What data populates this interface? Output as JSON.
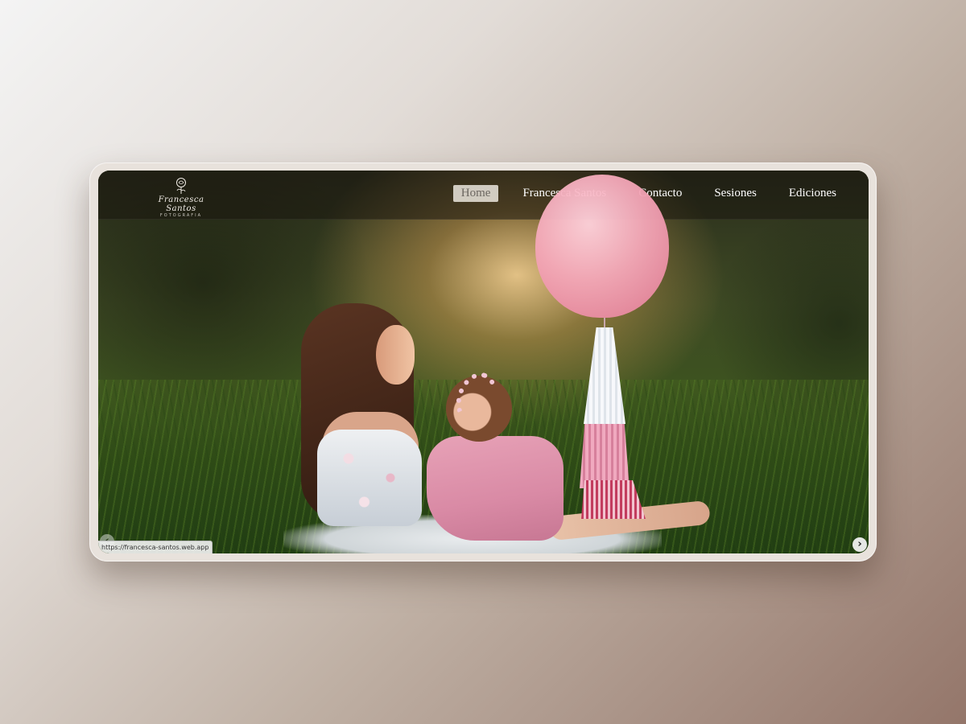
{
  "brand": {
    "logo_script": "Francesca Santos",
    "logo_sub": "FOTOGRAFIA"
  },
  "nav": {
    "items": [
      "Home",
      "Francesca Santos",
      "Contacto",
      "Sesiones",
      "Ediciones"
    ],
    "active": "Home"
  },
  "hero": {
    "image": "mother-and-baby-with-pink-balloon-photo"
  },
  "status_bar": {
    "url": "https://francesca-santos.web.app"
  },
  "slider": {
    "prev_icon": "chevron-left-icon",
    "next_icon": "chevron-right-icon",
    "prev_glyph": "‹",
    "next_glyph": "›"
  },
  "colors": {
    "nav_bg": "#19160f",
    "active_bg": "#ebe6de",
    "balloon": "#f4a7b8",
    "dress": "#d98aa5"
  }
}
